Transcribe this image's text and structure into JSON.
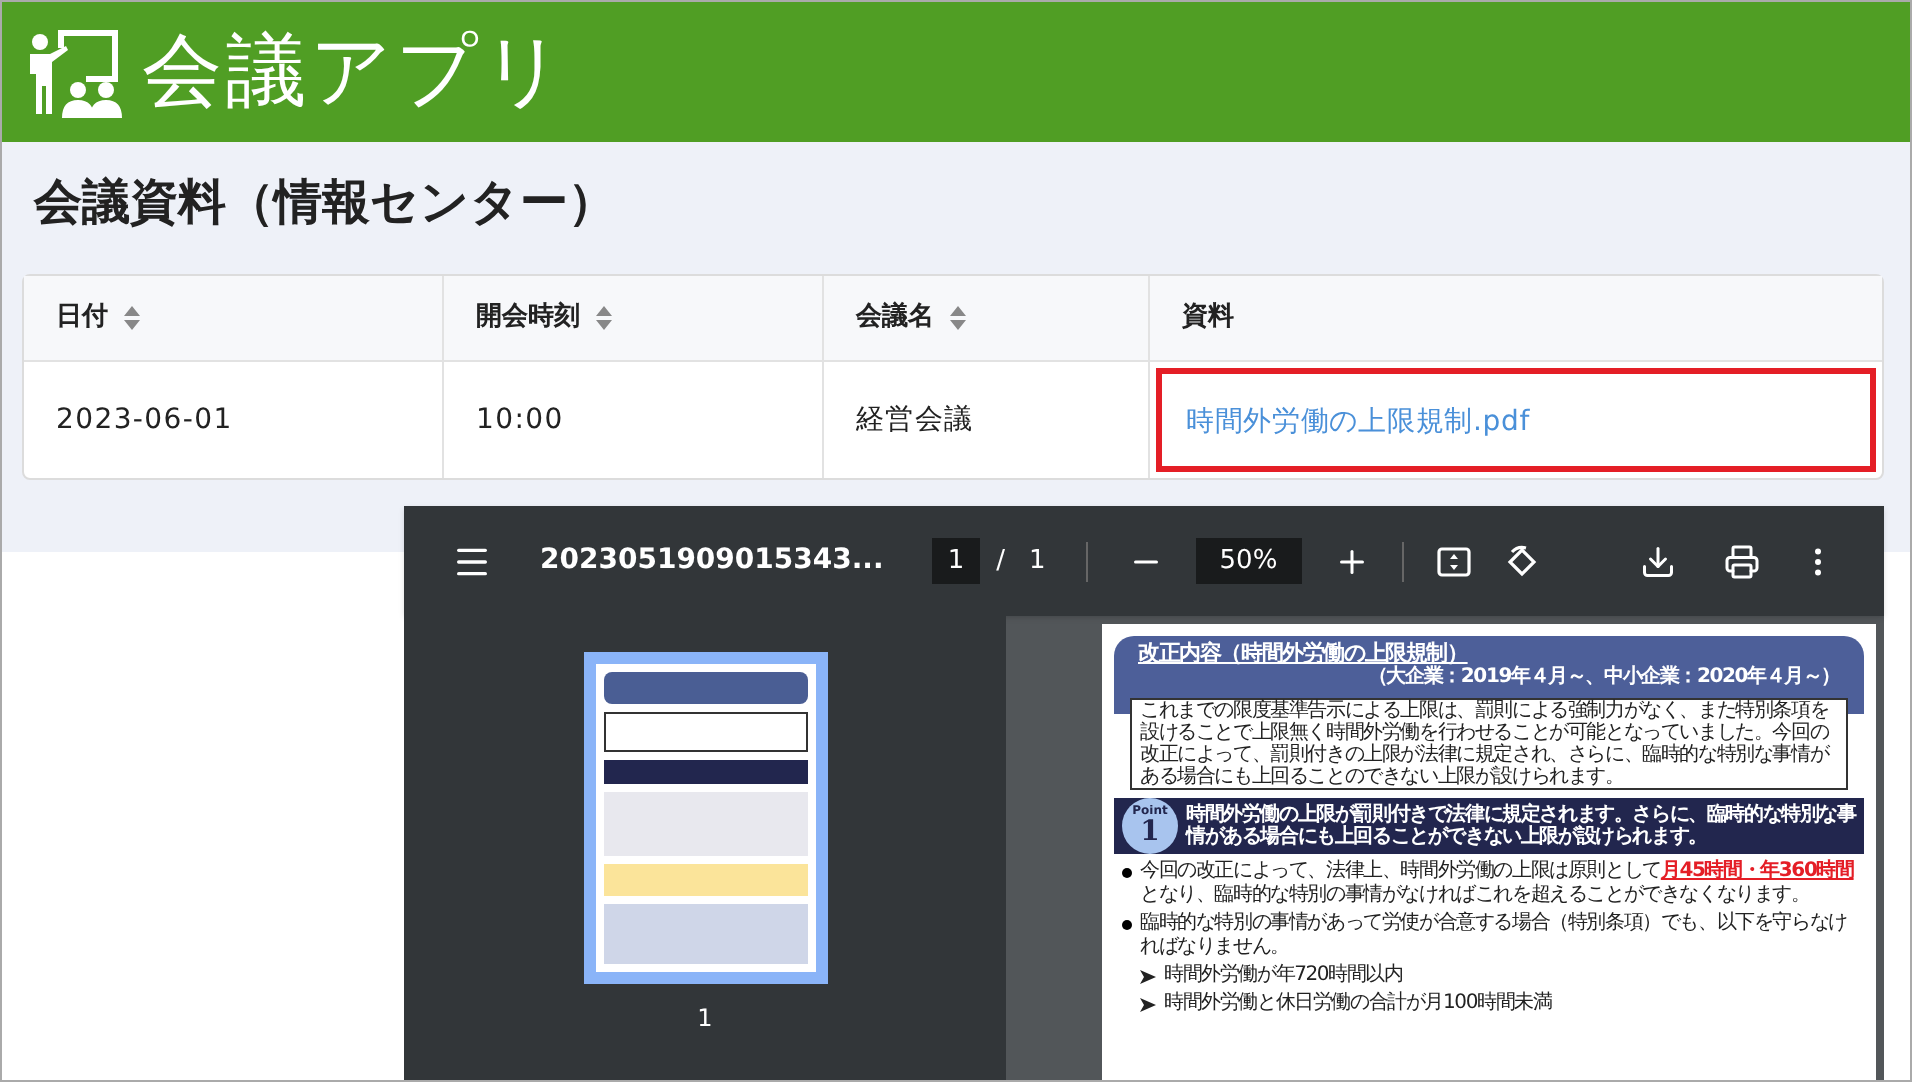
{
  "header": {
    "app_title": "会議アプリ"
  },
  "page_title": "会議資料（情報センター）",
  "table": {
    "columns": [
      {
        "label": "日付",
        "sortable": true
      },
      {
        "label": "開会時刻",
        "sortable": true
      },
      {
        "label": "会議名",
        "sortable": true
      },
      {
        "label": "資料",
        "sortable": false
      }
    ],
    "rows": [
      {
        "cells": [
          {
            "kind": "text",
            "text": "2023-06-01"
          },
          {
            "kind": "text",
            "text": "10:00"
          },
          {
            "kind": "text",
            "text": "経営会議"
          },
          {
            "kind": "link",
            "text": "時間外労働の上限規制.pdf",
            "highlighted": true
          }
        ]
      }
    ]
  },
  "pdf_viewer": {
    "file_name": "2023051909015343...",
    "page_input": "1",
    "page_separator": "/",
    "page_total": "1",
    "zoom": "50%",
    "thumbnails": [
      {
        "label": "1",
        "selected": true
      }
    ],
    "document": {
      "title": "改正内容（時間外労働の上限規制）",
      "subtitle": "（大企業：2019年４月～、中小企業：2020年４月～）",
      "intro": "これまでの限度基準告示による上限は、罰則による強制力がなく、また特別条項を設けることで上限無く時間外労働を行わせることが可能となっていました。今回の改正によって、罰則付きの上限が法律に規定され、さらに、臨時的な特別な事情がある場合にも上回ることのできない上限が設けられます。",
      "point": {
        "badge_label": "Point",
        "badge_number": "1",
        "text": "時間外労働の上限が罰則付きで法律に規定されます。さらに、臨時的な特別な事情がある場合にも上回ることができない上限が設けられます。"
      },
      "bullets": [
        {
          "text": "今回の改正によって、法律上、時間外労働の上限は原則として**月45時間・年360時間**となり、臨時的な特別の事情がなければこれを超えることができなくなります。"
        },
        {
          "text": "臨時的な特別の事情があって労使が合意する場合（特別条項）でも、以下を守らなければなりません。",
          "sub_items": [
            "時間外労働が年720時間以内",
            "時間外労働と休日労働の合計が月100時間未満"
          ]
        }
      ]
    }
  }
}
